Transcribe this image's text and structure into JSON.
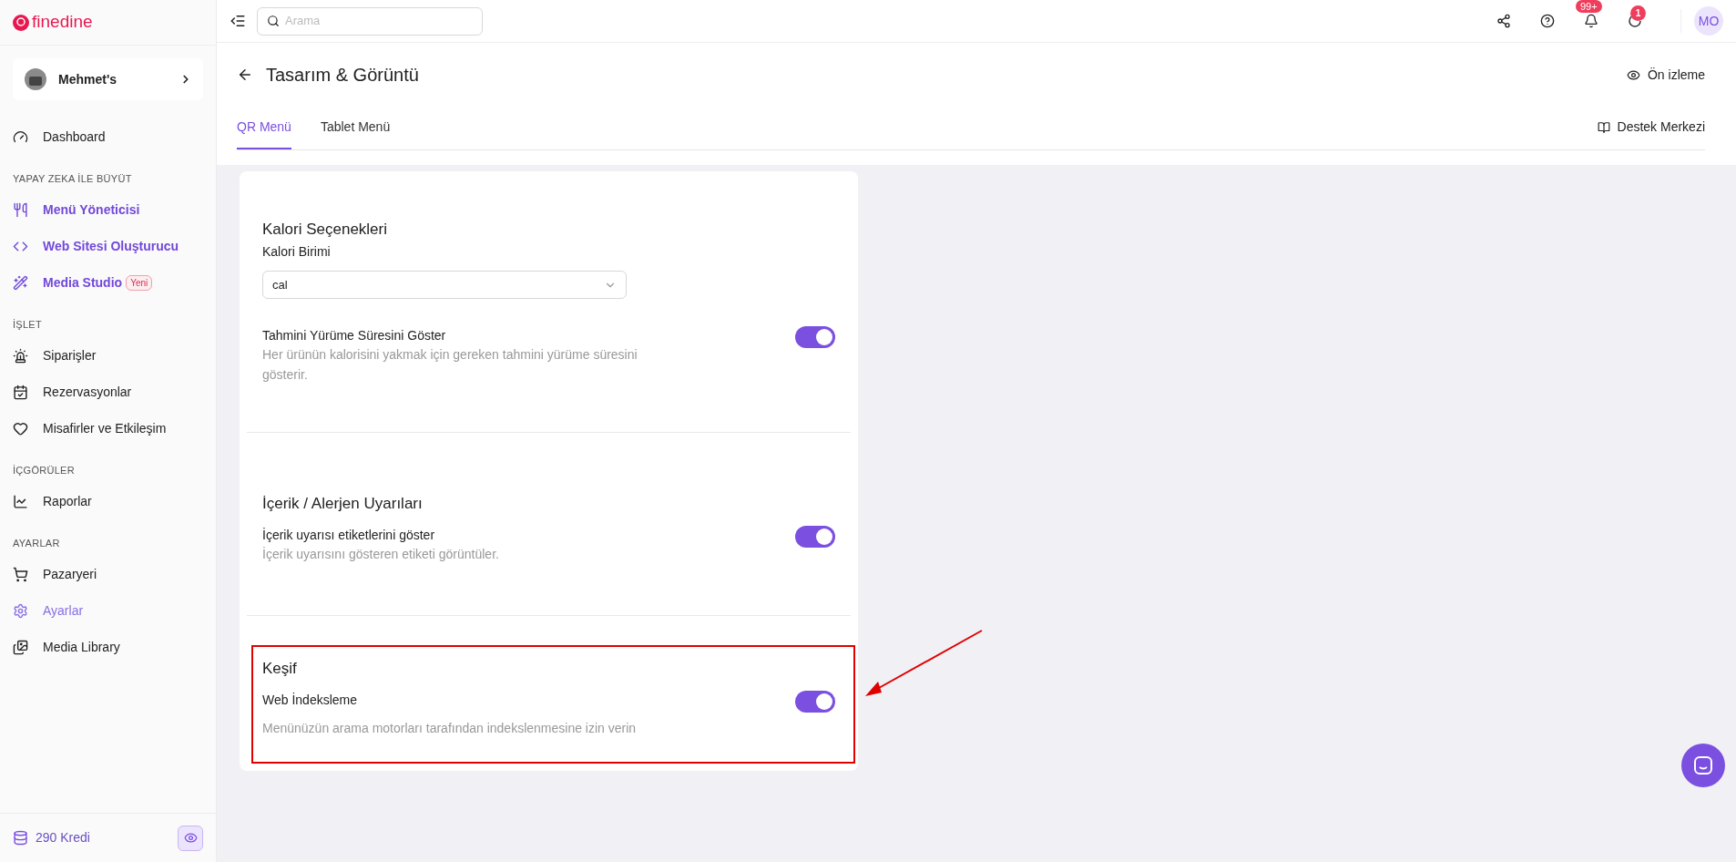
{
  "brand": {
    "name": "finedine"
  },
  "sidebar": {
    "venue": {
      "name": "Mehmet's"
    },
    "groups": [
      {
        "items": [
          {
            "label": "Dashboard",
            "featured": false,
            "selected": false
          }
        ]
      },
      {
        "heading": "YAPAY ZEKA İLE BÜYÜT",
        "items": [
          {
            "label": "Menü Yöneticisi",
            "featured": true,
            "selected": false
          },
          {
            "label": "Web Sitesi Oluşturucu",
            "featured": true,
            "selected": false
          },
          {
            "label": "Media Studio",
            "featured": true,
            "selected": false,
            "badge": "Yeni"
          }
        ]
      },
      {
        "heading": "İŞLET",
        "items": [
          {
            "label": "Siparişler",
            "featured": false,
            "selected": false
          },
          {
            "label": "Rezervasyonlar",
            "featured": false,
            "selected": false
          },
          {
            "label": "Misafirler ve Etkileşim",
            "featured": false,
            "selected": false
          }
        ]
      },
      {
        "heading": "İÇGÖRÜLER",
        "items": [
          {
            "label": "Raporlar",
            "featured": false,
            "selected": false
          }
        ]
      },
      {
        "heading": "AYARLAR",
        "items": [
          {
            "label": "Pazaryeri",
            "featured": false,
            "selected": false
          },
          {
            "label": "Ayarlar",
            "featured": false,
            "selected": true
          },
          {
            "label": "Media Library",
            "featured": false,
            "selected": false
          }
        ]
      }
    ],
    "credits": "290 Kredi"
  },
  "topbar": {
    "search": {
      "placeholder": "Arama"
    },
    "notifications_badge": "99+",
    "updates_badge": "1",
    "avatar": "MO"
  },
  "page": {
    "title": "Tasarım & Görüntü",
    "preview": "Ön izleme",
    "help": "Destek Merkezi",
    "tabs": [
      {
        "label": "QR Menü",
        "selected": true
      },
      {
        "label": "Tablet Menü",
        "selected": false
      }
    ]
  },
  "card": {
    "sections": [
      {
        "title": "Kalori Seçenekleri",
        "field_label": "Kalori Birimi",
        "select_value": "cal",
        "toggles": [
          {
            "label": "Tahmini Yürüme Süresini Göster",
            "description": "Her ürünün kalorisini yakmak için gereken tahmini yürüme süresini gösterir.",
            "on": true
          }
        ]
      },
      {
        "title": "İçerik / Alerjen Uyarıları",
        "toggles": [
          {
            "label": "İçerik uyarısı etiketlerini göster",
            "description": "İçerik uyarısını gösteren etiketi görüntüler.",
            "on": true
          }
        ]
      },
      {
        "title": "Keşif",
        "highlighted": true,
        "toggles": [
          {
            "label": "Web İndeksleme",
            "description": "Menünüzün arama motorları tarafından indekslenmesine izin verin",
            "on": true
          }
        ]
      }
    ]
  }
}
